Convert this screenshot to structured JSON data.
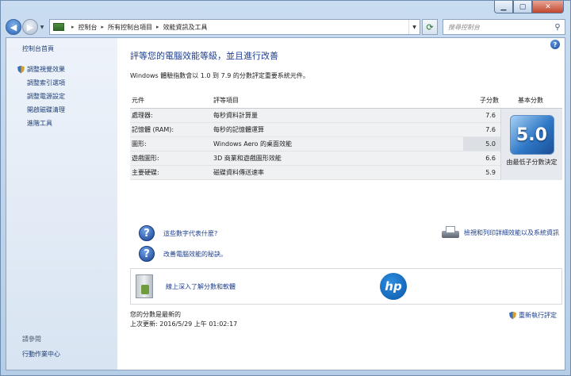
{
  "window": {
    "min_glyph": "▁",
    "max_glyph": "▢",
    "close_glyph": "✕"
  },
  "address": {
    "crumbs": [
      "控制台",
      "所有控制台項目",
      "效能資訊及工具"
    ],
    "separator": "▸",
    "search_placeholder": "搜尋控制台"
  },
  "sidebar": {
    "home": "控制台首頁",
    "items": [
      "調整視覺效果",
      "調整索引選項",
      "調整電源設定",
      "開啟磁碟清理",
      "進階工具"
    ],
    "see_also": "請參閱",
    "action_center": "行動作業中心"
  },
  "main": {
    "heading": "評等您的電腦效能等級，並且進行改善",
    "description": "Windows 體驗指數會以 1.0 到 7.9 的分數評定重要系統元件。",
    "columns": {
      "component": "元件",
      "rating": "評等項目",
      "subscore": "子分數",
      "basescore": "基本分數"
    },
    "rows": [
      {
        "component": "處理器:",
        "rating": "每秒資料計算量",
        "subscore": "7.6"
      },
      {
        "component": "記憶體 (RAM):",
        "rating": "每秒的記憶體運算",
        "subscore": "7.6"
      },
      {
        "component": "圖形:",
        "rating": "Windows Aero 的桌面效能",
        "subscore": "5.0"
      },
      {
        "component": "遊戲圖形:",
        "rating": "3D 商業和遊戲圖形效能",
        "subscore": "6.6"
      },
      {
        "component": "主要硬碟:",
        "rating": "磁碟資料傳送速率",
        "subscore": "5.9"
      }
    ],
    "base_score": "5.0",
    "base_caption": "由最低子分數決定",
    "link_meaning": "這些數字代表什麼?",
    "link_tips": "改善電腦效能的秘訣。",
    "link_print": "檢視和列印詳細效能以及系統資訊",
    "link_learn": "線上深入了解分數和軟體",
    "hp_logo": "hp",
    "status_line1": "您的分數是最新的",
    "status_line2": "上次更新: 2016/5/29 上午 01:02:17",
    "rerun": "重新執行評定"
  },
  "colors": {
    "link": "#1e3f8f",
    "heading": "#1e3f8f",
    "badge": "#2f78c7"
  }
}
